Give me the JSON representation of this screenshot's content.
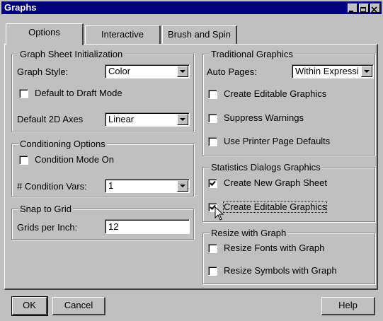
{
  "window": {
    "title": "Graphs"
  },
  "tabs": [
    {
      "label": "Options"
    },
    {
      "label": "Interactive"
    },
    {
      "label": "Brush and Spin"
    }
  ],
  "graph_sheet_init": {
    "legend": "Graph Sheet Initialization",
    "graph_style_label": "Graph Style:",
    "graph_style_value": "Color",
    "default_draft_label": "Default to Draft Mode",
    "default_draft_checked": false,
    "default_axes_label": "Default 2D Axes",
    "default_axes_value": "Linear"
  },
  "conditioning": {
    "legend": "Conditioning Options",
    "condition_mode_label": "Condition Mode On",
    "condition_mode_checked": false,
    "condition_vars_label": "# Condition Vars:",
    "condition_vars_value": "1"
  },
  "snap": {
    "legend": "Snap to Grid",
    "grids_label": "Grids per Inch:",
    "grids_value": "12"
  },
  "traditional": {
    "legend": "Traditional Graphics",
    "auto_pages_label": "Auto Pages:",
    "auto_pages_value": "Within Expressi",
    "create_editable_label": "Create Editable Graphics",
    "suppress_warnings_label": "Suppress Warnings",
    "printer_defaults_label": "Use Printer Page Defaults"
  },
  "stats_dialogs": {
    "legend": "Statistics Dialogs Graphics",
    "new_sheet_label": "Create New Graph Sheet",
    "new_sheet_checked": true,
    "editable_label": "Create Editable Graphics",
    "editable_checked": true
  },
  "resize": {
    "legend": "Resize with Graph",
    "fonts_label": "Resize Fonts with Graph",
    "symbols_label": "Resize Symbols with Graph"
  },
  "buttons": {
    "ok": "OK",
    "cancel": "Cancel",
    "help": "Help"
  }
}
